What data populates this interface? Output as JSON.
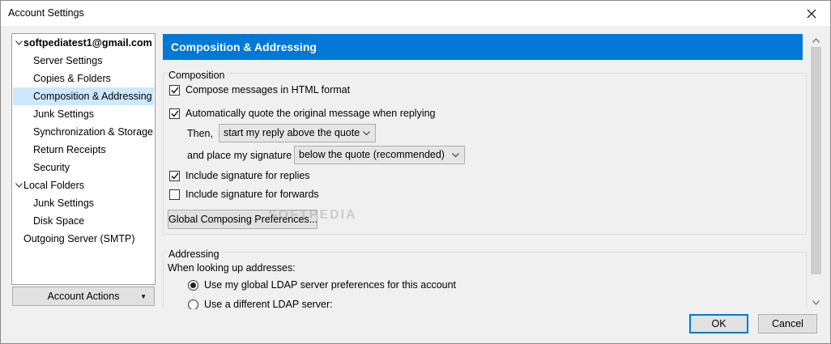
{
  "window": {
    "title": "Account Settings",
    "close_icon": "close-icon"
  },
  "tree": {
    "items": [
      {
        "label": "softpediatest1@gmail.com",
        "expanded": true,
        "bold": true
      },
      {
        "label": "Server Settings"
      },
      {
        "label": "Copies & Folders"
      },
      {
        "label": "Composition & Addressing",
        "selected": true
      },
      {
        "label": "Junk Settings"
      },
      {
        "label": "Synchronization & Storage"
      },
      {
        "label": "Return Receipts"
      },
      {
        "label": "Security"
      },
      {
        "label": "Local Folders",
        "expanded": true
      },
      {
        "label": "Junk Settings"
      },
      {
        "label": "Disk Space"
      },
      {
        "label": "Outgoing Server (SMTP)"
      }
    ],
    "account_actions_label": "Account Actions"
  },
  "main": {
    "header": "Composition & Addressing",
    "composition": {
      "caption": "Composition",
      "html_format_label": "Compose messages in HTML format",
      "html_format_checked": true,
      "auto_quote_label": "Automatically quote the original message when replying",
      "auto_quote_checked": true,
      "then_label": "Then,",
      "reply_position_value": "start my reply above the quote",
      "signature_label": "and place my signature",
      "signature_position_value": "below the quote (recommended)",
      "sig_replies_label": "Include signature for replies",
      "sig_replies_checked": true,
      "sig_forwards_label": "Include signature for forwards",
      "sig_forwards_checked": false,
      "global_prefs_button": "Global Composing Preferences..."
    },
    "addressing": {
      "caption": "Addressing",
      "lookup_label": "When looking up addresses:",
      "radio_global_label": "Use my global LDAP server preferences for this account",
      "radio_global_selected": true,
      "radio_different_label": "Use a different LDAP server:",
      "radio_different_selected": false
    }
  },
  "footer": {
    "ok_label": "OK",
    "cancel_label": "Cancel"
  },
  "watermark": "SOFTPEDIA",
  "colors": {
    "accent": "#0078d7",
    "selection": "#cce8ff"
  }
}
